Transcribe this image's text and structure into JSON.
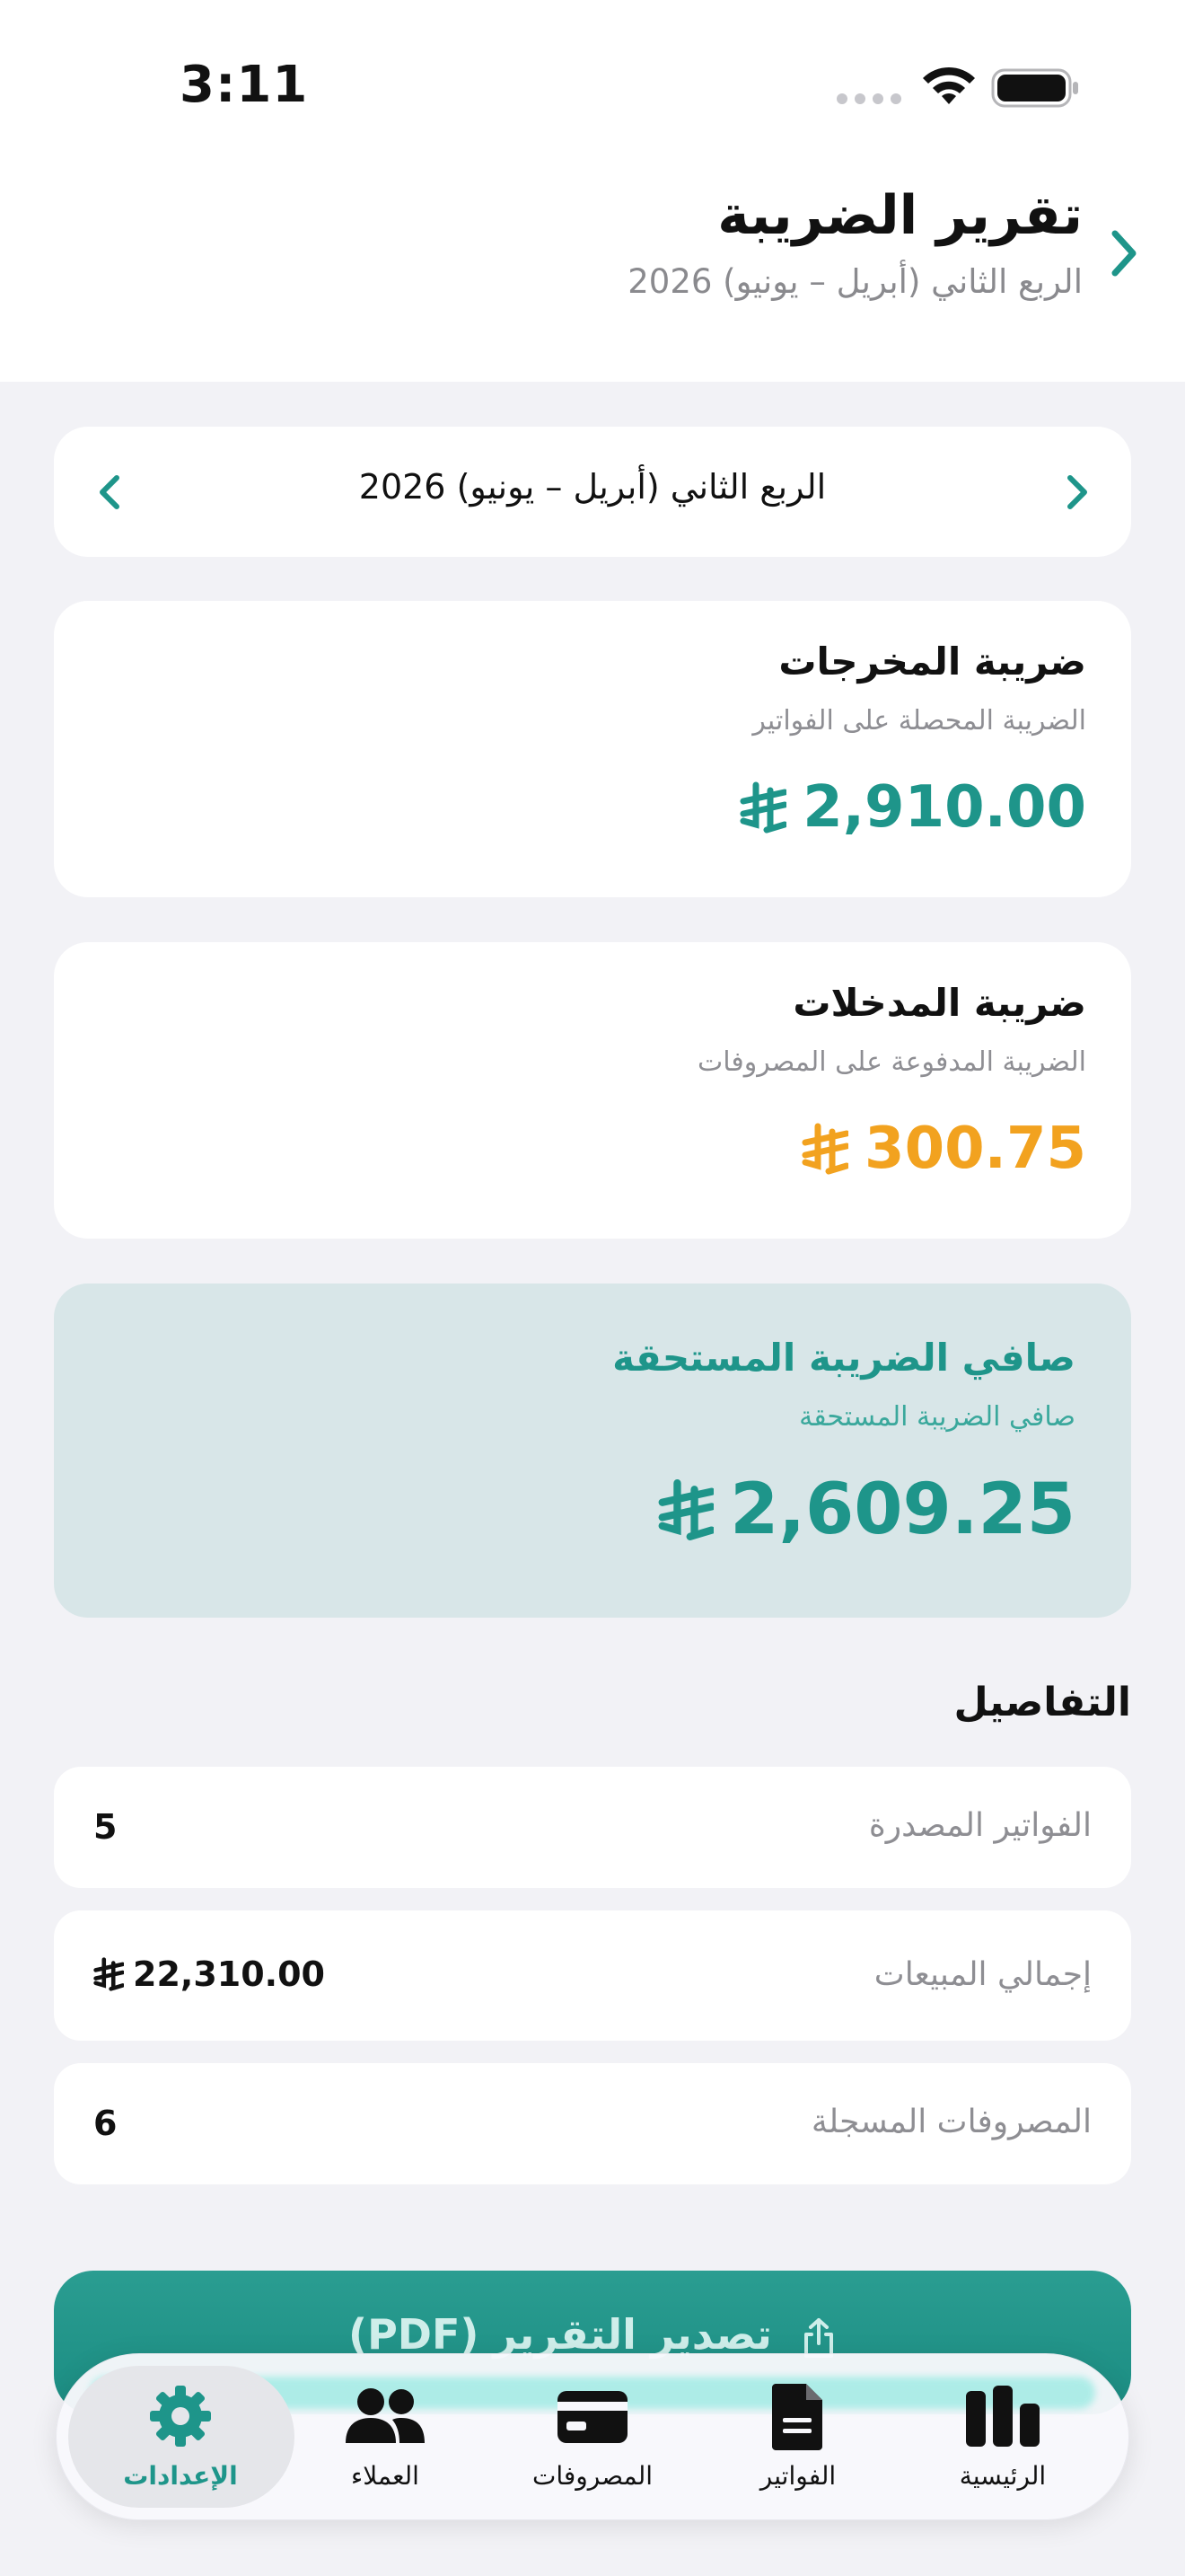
{
  "status_bar": {
    "time": "3:11"
  },
  "header": {
    "title": "تقرير الضريبة",
    "subtitle": "الربع الثاني (أبريل – يونيو) 2026"
  },
  "quarter_selector": {
    "label": "الربع الثاني (أبريل – يونيو) 2026"
  },
  "output_tax": {
    "title": "ضريبة المخرجات",
    "subtitle": "الضريبة المحصلة على الفواتير",
    "amount": "2,910.00",
    "color": "#1e958a"
  },
  "input_tax": {
    "title": "ضريبة المدخلات",
    "subtitle": "الضريبة المدفوعة على المصروفات",
    "amount": "300.75",
    "color": "#f2a21f"
  },
  "net_tax": {
    "title": "صافي الضريبة المستحقة",
    "subtitle": "صافي الضريبة المستحقة",
    "amount": "2,609.25",
    "color": "#1e958a"
  },
  "details": {
    "title": "التفاصيل",
    "rows": [
      {
        "label": "الفواتير المصدرة",
        "value": "5"
      },
      {
        "label": "إجمالي المبيعات",
        "value": "22,310.00"
      },
      {
        "label": "المصروفات المسجلة",
        "value": "6"
      }
    ]
  },
  "export_button": {
    "label": "تصدير التقرير (PDF)"
  },
  "tabbar": {
    "active": "settings",
    "items": [
      {
        "key": "settings",
        "label": "الإعدادات",
        "icon": "gear-icon"
      },
      {
        "key": "clients",
        "label": "العملاء",
        "icon": "people-icon"
      },
      {
        "key": "expenses",
        "label": "المصروفات",
        "icon": "credit-card-icon"
      },
      {
        "key": "invoices",
        "label": "الفواتير",
        "icon": "document-icon"
      },
      {
        "key": "home",
        "label": "الرئيسية",
        "icon": "chart-bars-icon"
      }
    ]
  },
  "colors": {
    "accent": "#1e958a",
    "warning": "#f2a21f",
    "net_card_bg": "#d8e6e8"
  }
}
